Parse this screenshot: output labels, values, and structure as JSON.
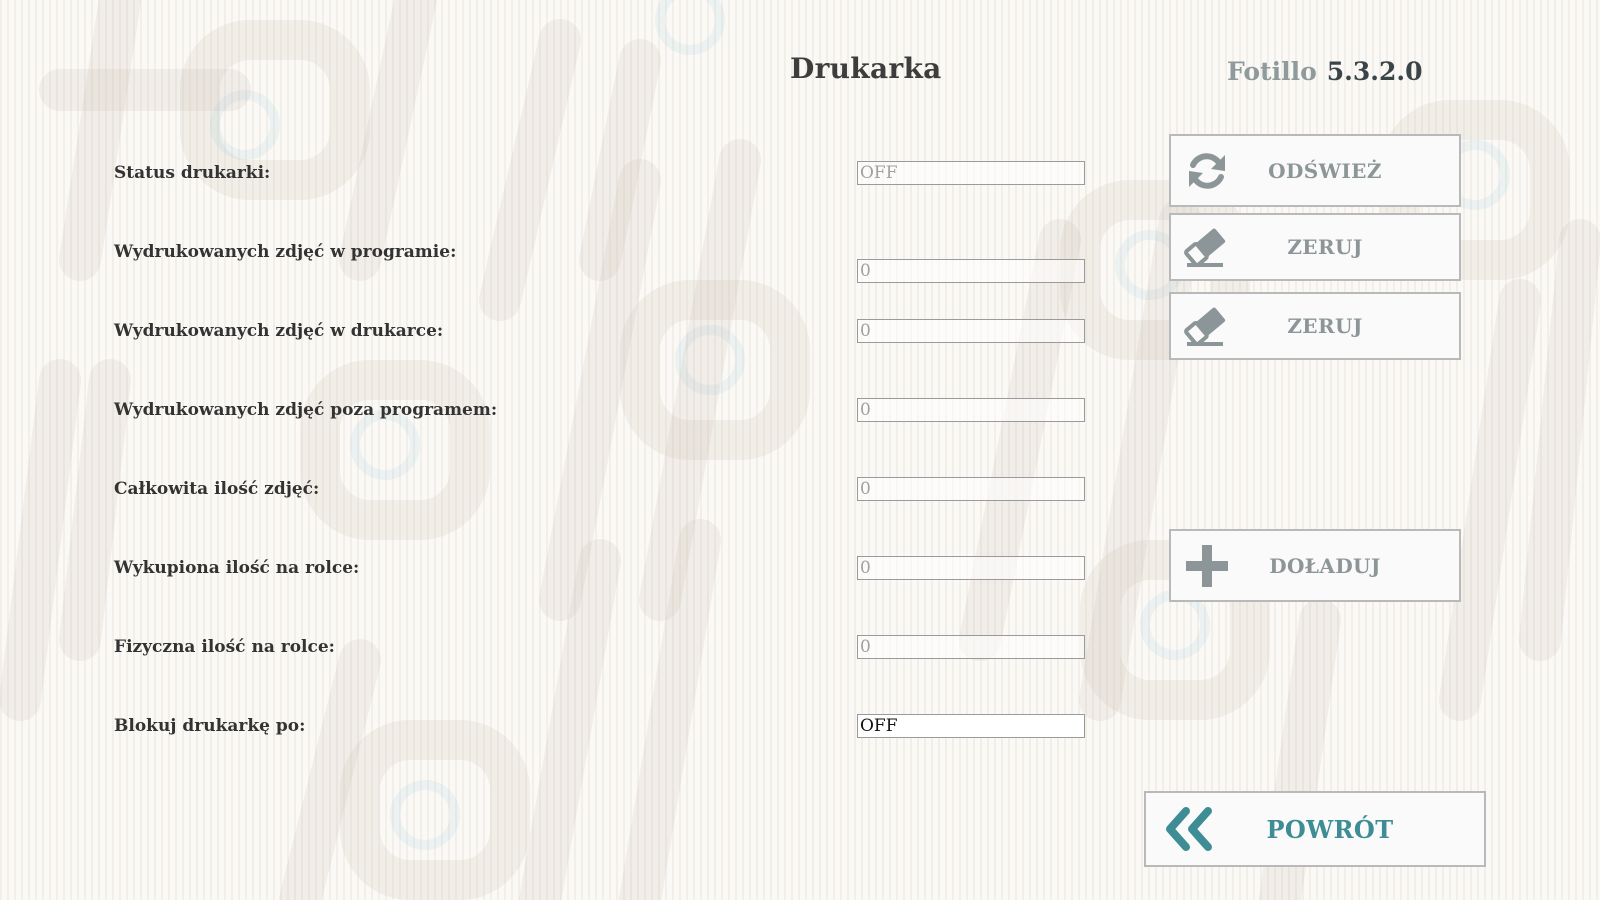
{
  "header": {
    "title": "Drukarka",
    "brand_name": "Fotillo",
    "version": "5.3.2.0"
  },
  "rows": [
    {
      "label": "Status drukarki:",
      "value": "OFF"
    },
    {
      "label": "Wydrukowanych zdjęć w programie:",
      "value": "0"
    },
    {
      "label": "Wydrukowanych zdjęć w drukarce:",
      "value": "0"
    },
    {
      "label": "Wydrukowanych zdjęć poza programem:",
      "value": "0"
    },
    {
      "label": "Całkowita ilość zdjęć:",
      "value": "0"
    },
    {
      "label": "Wykupiona ilość na rolce:",
      "value": "0"
    },
    {
      "label": "Fizyczna ilość na rolce:",
      "value": "0"
    },
    {
      "label": "Blokuj drukarkę po:",
      "value": "OFF"
    }
  ],
  "buttons": {
    "refresh": {
      "label": "ODŚWIEŻ",
      "icon": "refresh-icon"
    },
    "reset_program": {
      "label": "ZERUJ",
      "icon": "eraser-icon"
    },
    "reset_printer": {
      "label": "ZERUJ",
      "icon": "eraser-icon"
    },
    "topup": {
      "label": "DOŁADUJ",
      "icon": "plus-icon"
    },
    "back": {
      "label": "POWRÓT",
      "icon": "double-chevron-left-icon"
    }
  },
  "colors": {
    "icon_gray": "#8c9597",
    "accent_teal": "#3e8d95",
    "background": "#fbf9f6"
  }
}
